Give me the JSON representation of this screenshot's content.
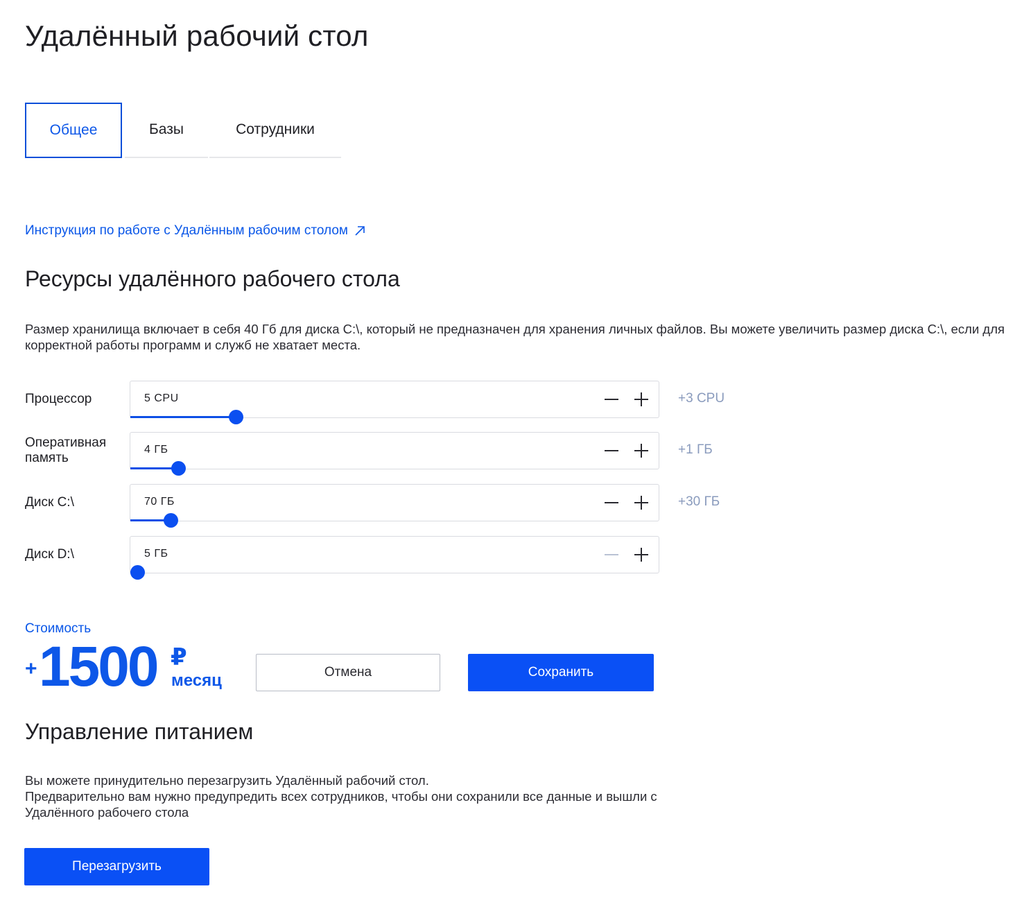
{
  "page": {
    "title": "Удалённый рабочий стол"
  },
  "tabs": [
    {
      "label": "Общее",
      "active": true
    },
    {
      "label": "Базы",
      "active": false
    },
    {
      "label": "Сотрудники",
      "active": false
    }
  ],
  "guide_link": {
    "label": "Инструкция по работе с Удалённым рабочим столом",
    "icon": "external-link-arrow-icon"
  },
  "resources": {
    "title": "Ресурсы удалённого рабочего стола",
    "description": "Размер хранилища включает в себя 40 Гб для диска С:\\, который не предназначен для хранения личных файлов. Вы можете увеличить размер диска С:\\, если для корректной работы программ и служб не хватает места.",
    "rows": [
      {
        "label": "Процессор",
        "value": "5 CPU",
        "delta": "+3 CPU",
        "fill_fraction": 0.2
      },
      {
        "label": "Оперативная память",
        "value": "4 ГБ",
        "delta": "+1 ГБ",
        "fill_fraction": 0.09
      },
      {
        "label": "Диск С:\\",
        "value": "70 ГБ",
        "delta": "+30 ГБ",
        "fill_fraction": 0.076
      },
      {
        "label": "Диск D:\\",
        "value": "5 ГБ",
        "delta": "",
        "fill_fraction": 0.0125,
        "minus_disabled": true
      }
    ]
  },
  "cost": {
    "label": "Стоимость",
    "sign": "+",
    "amount": "1500",
    "currency": "₽",
    "period": "месяц"
  },
  "actions": {
    "cancel": "Отмена",
    "save": "Сохранить"
  },
  "power": {
    "title": "Управление питанием",
    "description_lines": [
      "Вы можете принудительно перезагрузить Удалённый рабочий стол.",
      "Предварительно вам нужно предупредить всех сотрудников, чтобы они сохранили все данные и вышли с Удалённого рабочего стола"
    ],
    "restart_label": "Перезагрузить"
  },
  "colors": {
    "accent": "#0a50f5",
    "link": "#0a57e8",
    "delta": "#8a9bbd",
    "border": "#d9dbe0"
  }
}
